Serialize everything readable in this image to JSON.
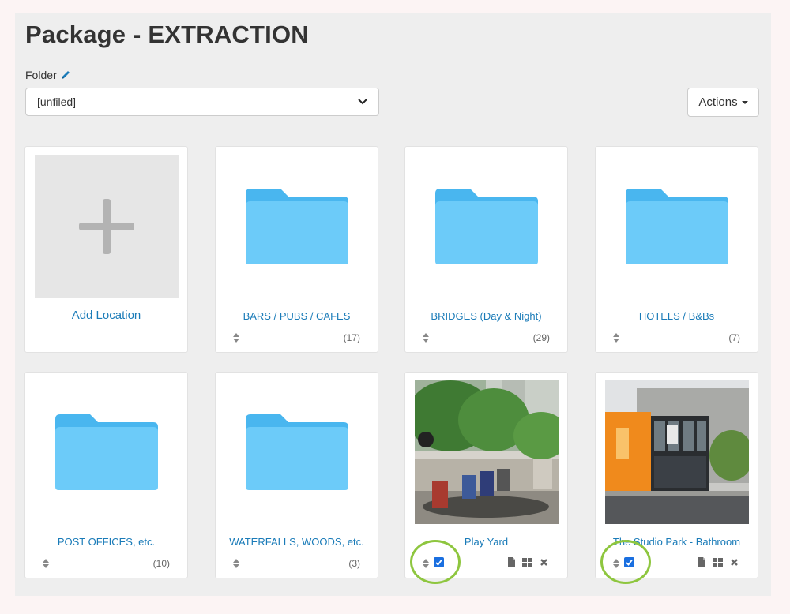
{
  "header": {
    "title": "Package - EXTRACTION",
    "folder_label": "Folder",
    "folder_value": "[unfiled]",
    "actions_label": "Actions"
  },
  "cards": [
    {
      "kind": "add",
      "title": "Add Location"
    },
    {
      "kind": "folder",
      "title": "BARS / PUBS / CAFES",
      "count": "(17)"
    },
    {
      "kind": "folder",
      "title": "BRIDGES (Day & Night)",
      "count": "(29)"
    },
    {
      "kind": "folder",
      "title": "HOTELS / B&Bs",
      "count": "(7)"
    },
    {
      "kind": "folder",
      "title": "POST OFFICES, etc.",
      "count": "(10)"
    },
    {
      "kind": "folder",
      "title": "WATERFALLS, WOODS, etc.",
      "count": "(3)"
    },
    {
      "kind": "location",
      "title": "Play Yard",
      "checked": true
    },
    {
      "kind": "location",
      "title": "The Studio Park - Bathroom",
      "checked": true
    }
  ],
  "colors": {
    "accent": "#1a7bb8",
    "folder": "#5ac4f7",
    "highlight": "#8ec63f"
  }
}
